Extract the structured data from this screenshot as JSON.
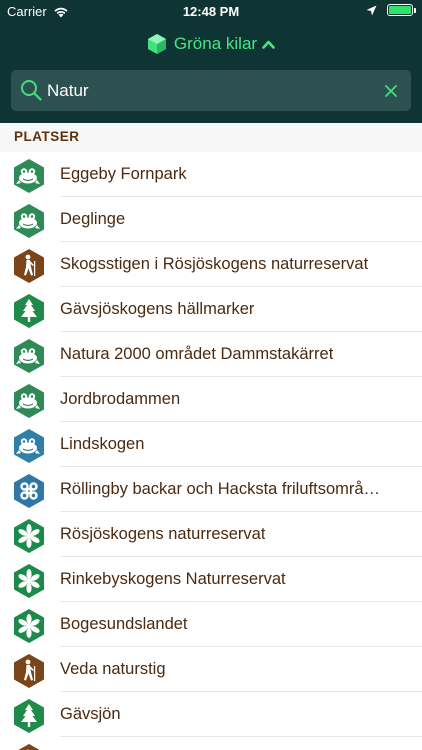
{
  "status_bar": {
    "carrier": "Carrier",
    "time": "12:48 PM"
  },
  "header": {
    "title": "Gröna kilar"
  },
  "search": {
    "value": "Natur",
    "placeholder": ""
  },
  "section": {
    "title": "PLATSER"
  },
  "colors": {
    "header_bg": "#0e3434",
    "search_bg": "#2d5050",
    "accent": "#41e07b",
    "frog_green": "#2e8b57",
    "forest_green": "#1f8a49",
    "flower_green": "#1c8a4a",
    "hiker_brown": "#7b4519",
    "frog_blue": "#2f7fa6",
    "playground_blue": "#2f78a6",
    "label_brown": "#4b2a10"
  },
  "places": [
    {
      "label": "Eggeby Fornpark",
      "icon": "frog-icon",
      "color": "#2e8b57"
    },
    {
      "label": "Deglinge",
      "icon": "frog-icon",
      "color": "#2e8b57"
    },
    {
      "label": "Skogsstigen i Rösjöskogens naturreservat",
      "icon": "hiker-icon",
      "color": "#7b4519"
    },
    {
      "label": "Gävsjöskogens hällmarker",
      "icon": "tree-icon",
      "color": "#1f8a49"
    },
    {
      "label": "Natura 2000 området Dammstakärret",
      "icon": "frog-icon",
      "color": "#2e8b57"
    },
    {
      "label": "Jordbrodammen",
      "icon": "frog-icon",
      "color": "#2e8b57"
    },
    {
      "label": "Lindskogen",
      "icon": "frog-icon",
      "color": "#2f7fa6"
    },
    {
      "label": "Röllingby backar och Hacksta friluftsområ…",
      "icon": "playground-icon",
      "color": "#2f78a6"
    },
    {
      "label": "Rösjöskogens naturreservat",
      "icon": "flower-icon",
      "color": "#1c8a4a"
    },
    {
      "label": "Rinkebyskogens Naturreservat",
      "icon": "flower-icon",
      "color": "#1c8a4a"
    },
    {
      "label": "Bogesundslandet",
      "icon": "flower-icon",
      "color": "#1c8a4a"
    },
    {
      "label": "Veda naturstig",
      "icon": "hiker-icon",
      "color": "#7b4519"
    },
    {
      "label": "Gävsjön",
      "icon": "tree-icon",
      "color": "#1f8a49"
    },
    {
      "label": "",
      "icon": "hiker-icon",
      "color": "#7b4519"
    }
  ]
}
